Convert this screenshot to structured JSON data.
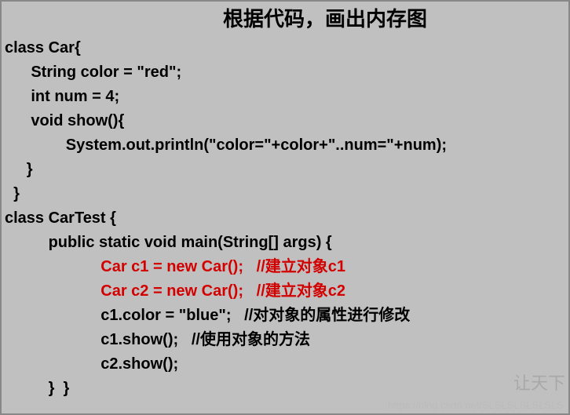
{
  "title": "根据代码，画出内存图",
  "code": {
    "l1": "class Car{",
    "l2": "      String color = \"red\";",
    "l3": "      int num = 4;",
    "l4": "      void show(){",
    "l5": "              System.out.println(\"color=\"+color+\"..num=\"+num);",
    "l6": "     }",
    "l7": "  }",
    "l8": "class CarTest {",
    "l9": "          public static void main(String[] args) {",
    "l10": "                      Car c1 = new Car();   //建立对象c1",
    "l11": "                      Car c2 = new Car();   //建立对象c2",
    "l12_pre": "                      ",
    "l12_a": "c1.color = \"blue\";   ",
    "l12_b": "//对对象的属性进行修改",
    "l13_pre": "                      ",
    "l13_a": "c1.show();   ",
    "l13_b": "//使用对象的方法",
    "l14": "                      c2.show();",
    "l15": "          }  }"
  },
  "watermark": "让天下",
  "url": "https://blog.csdn.net/SLSLSLSLSLSLS"
}
